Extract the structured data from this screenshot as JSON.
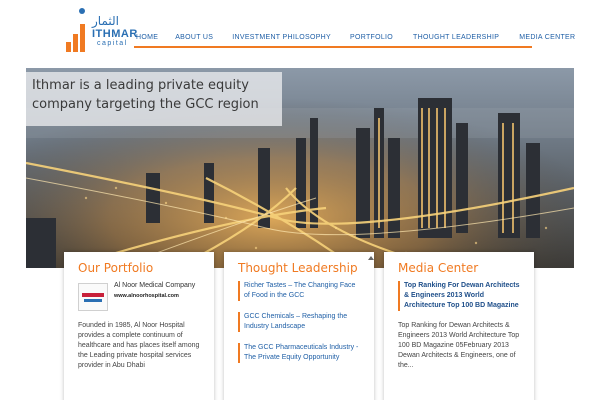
{
  "brand": {
    "arabic": "الثمار",
    "name": "ITHMAR",
    "sub": "capital",
    "colors": {
      "orange": "#f07a22",
      "blue": "#2a6fb3"
    }
  },
  "nav": {
    "items": [
      {
        "label": "HOME"
      },
      {
        "label": "ABOUT US"
      },
      {
        "label": "INVESTMENT PHILOSOPHY"
      },
      {
        "label": "PORTFOLIO"
      },
      {
        "label": "THOUGHT LEADERSHIP"
      },
      {
        "label": "MEDIA CENTER"
      }
    ]
  },
  "hero": {
    "tagline": "Ithmar is a leading private equity company targeting the GCC region"
  },
  "portfolio": {
    "heading": "Our Portfolio",
    "company_name": "Al Noor Medical Company",
    "company_url": "www.alnoorhospital.com",
    "description": "Founded in 1985, Al Noor Hospital provides a complete continuum of healthcare and has places itself among the Leading private hospital services provider in Abu Dhabi"
  },
  "thought": {
    "heading": "Thought Leadership",
    "items": [
      {
        "title": "Richer Tastes – The Changing Face of Food in the GCC"
      },
      {
        "title": "GCC Chemicals – Reshaping the Industry Landscape"
      },
      {
        "title": "The GCC Pharmaceuticals Industry -The Private Equity Opportunity"
      }
    ]
  },
  "media": {
    "heading": "Media Center",
    "title": "Top Ranking For Dewan Architects & Engineers 2013 World Architecture Top 100 BD Magazine",
    "body": "Top Ranking for Dewan Architects & Engineers 2013 World Architecture Top 100 BD Magazine 05February 2013  Dewan Architects & Engineers, one of the..."
  }
}
